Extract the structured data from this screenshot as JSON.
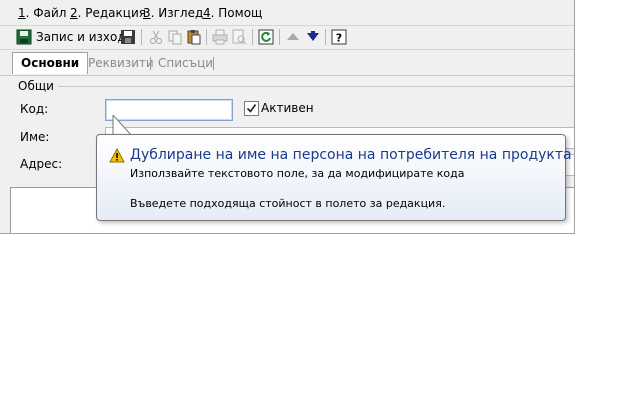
{
  "menu": [
    {
      "key": "1",
      "label": ". Файл"
    },
    {
      "key": "2",
      "label": ". Редакция"
    },
    {
      "key": "3",
      "label": ". Изглед"
    },
    {
      "key": "4",
      "label": ". Помощ"
    }
  ],
  "toolbar": {
    "save_exit_label": "Запис и изход"
  },
  "tabs": [
    {
      "label": "Основни",
      "active": true
    },
    {
      "label": "Реквизити",
      "active": false
    },
    {
      "label": "Списъци",
      "active": false
    }
  ],
  "form": {
    "group_label": "Общи",
    "code_label": "Код:",
    "code_value": "",
    "active_label": "Активен",
    "active_checked": true,
    "name_label": "Име:",
    "address_label": "Адрес:"
  },
  "balloon": {
    "title": "Дублиране на име на персона на потребителя на продукта",
    "line1": "Използвайте текстовото поле, за да модифицирате кода",
    "line2": "Въведете подходяща стойност в полето за редакция."
  },
  "colors": {
    "balloon_title": "#1c3a8c",
    "warning": "#f5c400",
    "save_icon": "#1f6f3a"
  }
}
